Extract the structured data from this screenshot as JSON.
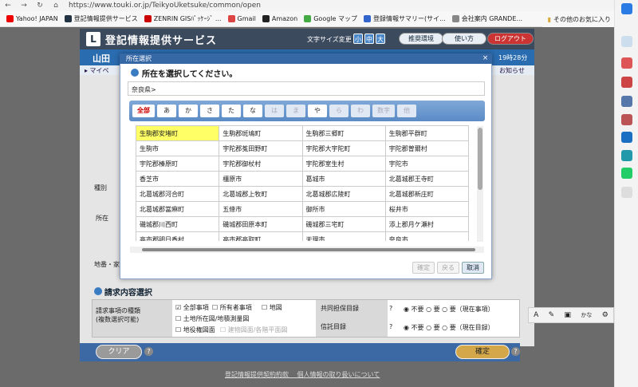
{
  "browser": {
    "url": "https://www.touki.or.jp/TeikyoUketsuke/common/open",
    "bookmarks": [
      {
        "label": "Yahoo! JAPAN",
        "color": "#e00"
      },
      {
        "label": "登記情報提供サービス",
        "color": "#234"
      },
      {
        "label": "ZENRIN GISﾊﾟｯｹｰｼﾞ ...",
        "color": "#c00"
      },
      {
        "label": "Gmail",
        "color": "#d44"
      },
      {
        "label": "Amazon",
        "color": "#222"
      },
      {
        "label": "Google マップ",
        "color": "#4a4"
      },
      {
        "label": "登録情報サマリー(サイ...",
        "color": "#36c"
      },
      {
        "label": "会社案内 GRANDE...",
        "color": "#888"
      }
    ],
    "other_favorites": "その他のお気に入り"
  },
  "header": {
    "title": "登記情報提供サービス",
    "font_size_label": "文字サイズ変更",
    "font_sizes": [
      "小",
      "中",
      "大"
    ],
    "env_button": "推奨環境",
    "help_button": "使い方",
    "logout_button": "ログアウト"
  },
  "userbar": {
    "name": "山田",
    "time": "19時28分"
  },
  "menubar": {
    "left": "▸ マイペ",
    "right": "お知らせ"
  },
  "dialog": {
    "title": "所在選択",
    "close": "×",
    "heading": "所在を選択してください。",
    "breadcrumb": "奈良県>",
    "tabs": [
      {
        "label": "全部",
        "state": "sel"
      },
      {
        "label": "あ",
        "state": "on"
      },
      {
        "label": "か",
        "state": "on"
      },
      {
        "label": "さ",
        "state": "on"
      },
      {
        "label": "た",
        "state": "on"
      },
      {
        "label": "な",
        "state": "on"
      },
      {
        "label": "は",
        "state": "dim"
      },
      {
        "label": "ま",
        "state": "dim"
      },
      {
        "label": "や",
        "state": "on"
      },
      {
        "label": "ら",
        "state": "dim"
      },
      {
        "label": "わ",
        "state": "dim"
      },
      {
        "label": "数字",
        "state": "dim"
      },
      {
        "label": "他",
        "state": "dim"
      }
    ],
    "rows": [
      [
        "生駒郡安堵町",
        "生駒郡斑鳩町",
        "生駒郡三郷町",
        "生駒郡平群町"
      ],
      [
        "生駒市",
        "宇陀郡菟田野町",
        "宇陀郡大宇陀町",
        "宇陀郡曽爾村"
      ],
      [
        "宇陀郡榛原町",
        "宇陀郡御杖村",
        "宇陀郡室生村",
        "宇陀市"
      ],
      [
        "香芝市",
        "橿原市",
        "葛城市",
        "北葛城郡王寺町"
      ],
      [
        "北葛城郡河合町",
        "北葛城郡上牧町",
        "北葛城郡広陵町",
        "北葛城郡新庄町"
      ],
      [
        "北葛城郡當麻町",
        "五條市",
        "御所市",
        "桜井市"
      ],
      [
        "磯城郡川西町",
        "磯城郡田原本町",
        "磯城郡三宅町",
        "添上郡月ケ瀬村"
      ],
      [
        "高市郡明日香村",
        "高市郡高取町",
        "天理市",
        "奈良市"
      ]
    ],
    "buttons": {
      "confirm": "確定",
      "back": "戻る",
      "cancel": "取消"
    }
  },
  "background": {
    "req_section": "請求内容選択",
    "req_type_label": "請求事項の種類\n(複数選択可能)",
    "checks": [
      "全部事項",
      "所有者事項",
      "地図",
      "土地所在図/地積測量図",
      "地役権図面",
      "建物図面/各階平面図"
    ],
    "joint_label": "共同担保目録",
    "trust_label": "信託目録",
    "joint_options": [
      "不要",
      "要",
      "要（現在事項）"
    ],
    "trust_options": [
      "不要",
      "要",
      "要（現在目録）"
    ],
    "side_labels": [
      "種別",
      "所在",
      "地番・家"
    ],
    "clear_button": "クリア",
    "confirm_button": "確定",
    "help": "?"
  },
  "footer": {
    "links": "登記情報提供契約約款　 個人情報の取り扱いについて"
  },
  "floattool": {
    "items": [
      "A",
      "✎",
      "▣",
      "かな",
      "⚙"
    ]
  }
}
